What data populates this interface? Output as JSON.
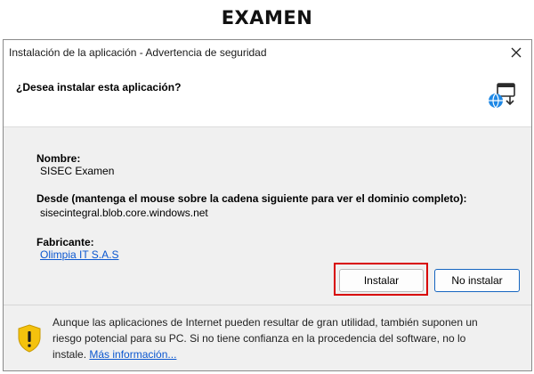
{
  "banner": {
    "title": "EXAMEN"
  },
  "window": {
    "title": "Instalación de la aplicación - Advertencia de seguridad",
    "close_icon": "close-icon"
  },
  "header": {
    "question": "¿Desea instalar esta aplicación?",
    "app_icon": "globe-download-icon"
  },
  "fields": {
    "name_label": "Nombre:",
    "name_value": "SISEC Examen",
    "from_label": "Desde (mantenga el mouse sobre la cadena siguiente para ver el dominio completo):",
    "from_value": "sisecintegral.blob.core.windows.net",
    "publisher_label": "Fabricante:",
    "publisher_value": "Olimpia IT S.A.S"
  },
  "buttons": {
    "install_label": "Instalar",
    "no_install_label": "No instalar"
  },
  "footer": {
    "warning_icon": "shield-warning-icon",
    "text": "Aunque las aplicaciones de Internet pueden resultar de gran utilidad, también suponen un riesgo potencial para su PC. Si no tiene confianza en la procedencia del software, no lo instale.",
    "link_label": "Más información..."
  },
  "colors": {
    "highlight": "#d80000",
    "primary_border": "#1565c0",
    "link": "#0b57d0",
    "shield": "#f4c20d"
  }
}
